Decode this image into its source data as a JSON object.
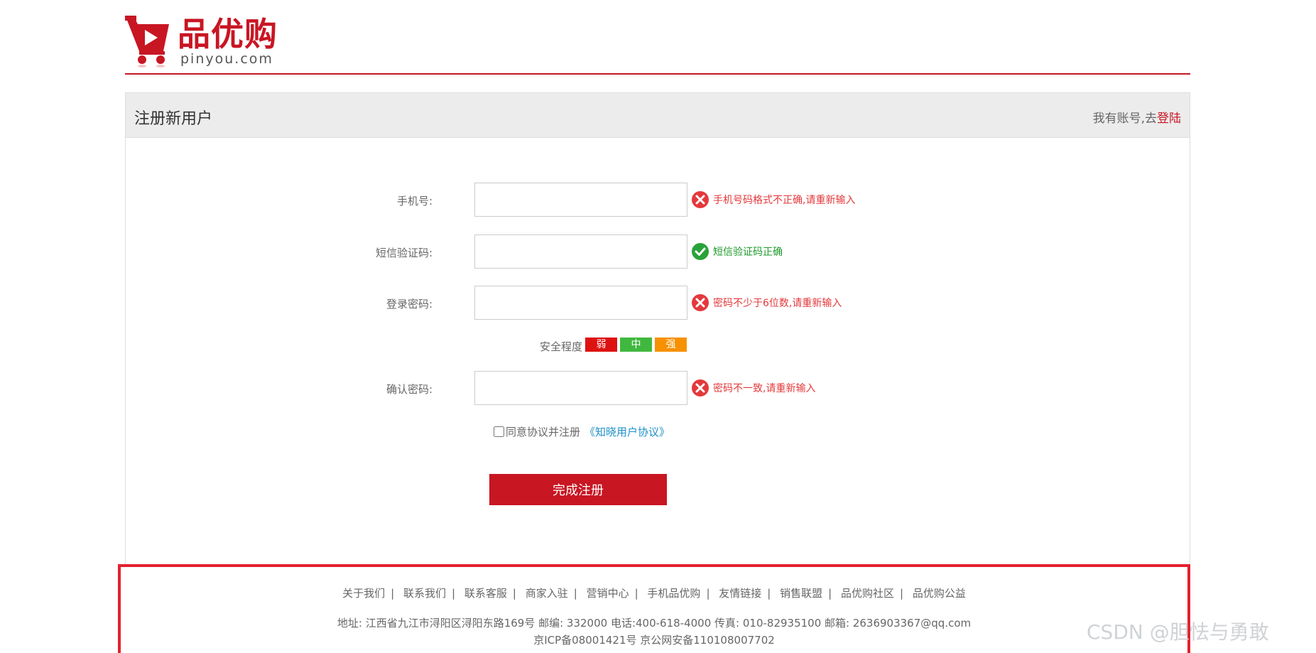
{
  "logo": {
    "cn": "品优购",
    "en": "pinyou.com"
  },
  "panel": {
    "title": "注册新用户",
    "login_prefix": "我有账号,去",
    "login_link": "登陆"
  },
  "form": {
    "phone": {
      "label": "手机号:",
      "value": "",
      "message": "手机号码格式不正确,请重新输入",
      "status": "error"
    },
    "sms": {
      "label": "短信验证码:",
      "value": "",
      "message": "短信验证码正确",
      "status": "ok"
    },
    "password": {
      "label": "登录密码:",
      "value": "",
      "message": "密码不少于6位数,请重新输入",
      "status": "error"
    },
    "strength": {
      "label": "安全程度",
      "levels": [
        "弱",
        "中",
        "强"
      ],
      "colors": [
        "#de1111",
        "#40b83f",
        "#f79100"
      ]
    },
    "confirm": {
      "label": "确认密码:",
      "value": "",
      "message": "密码不一致,请重新输入",
      "status": "error"
    },
    "agree": {
      "text": "同意协议并注册",
      "link": "《知晓用户协议》"
    },
    "submit": "完成注册"
  },
  "footer": {
    "links": [
      "关于我们",
      "联系我们",
      "联系客服",
      "商家入驻",
      "营销中心",
      "手机品优购",
      "友情链接",
      "销售联盟",
      "品优购社区",
      "品优购公益"
    ],
    "address": "地址: 江西省九江市浔阳区浔阳东路169号   邮编: 332000 电话:400-618-4000   传真: 010-82935100   邮箱: 2636903367@qq.com",
    "icp": "京ICP备08001421号  京公网安备110108007702"
  },
  "watermark": "CSDN @胆怯与勇敢",
  "colors": {
    "brand": "#c81623",
    "error": "#e4393c",
    "ok": "#1e9b2c"
  }
}
